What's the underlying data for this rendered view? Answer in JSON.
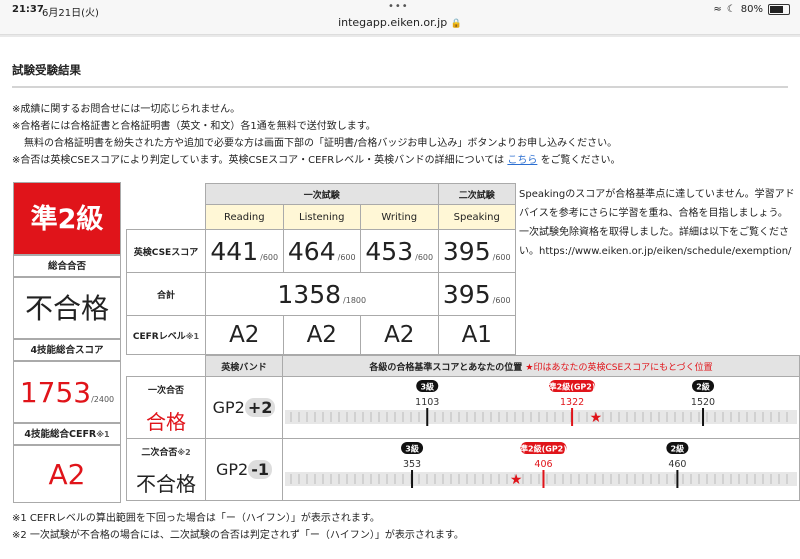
{
  "status_bar": {
    "time": "21:37",
    "date": "6月21日(火)",
    "url": "integapp.eiken.or.jp",
    "battery": "80%",
    "battery_level": 0.8
  },
  "page_title": "試験受験結果",
  "notes": {
    "n1": "※成績に関するお問合せには一切応じられません。",
    "n2": "※合格者には合格証書と合格証明書（英文・和文）各1通を無料で送付致します。",
    "n2b": "無料の合格証明書を紛失された方や追加で必要な方は画面下部の「証明書/合格バッジお申し込み」ボタンよりお申し込みください。",
    "n3_pre": "※合否は英検CSEスコアにより判定しています。英検CSEスコア・CEFRレベル・英検バンドの詳細については",
    "n3_link": "こちら",
    "n3_post": "をご覧ください。"
  },
  "summary": {
    "grade": "準2級",
    "overall_label": "総合合否",
    "overall_value": "不合格",
    "total4_label": "4技能総合スコア",
    "total4_value": "1753",
    "total4_max": "/2400",
    "cefr4_label": "4技能総合CEFR",
    "cefr4_note": "※1",
    "cefr4_value": "A2"
  },
  "scores": {
    "first_header": "一次試験",
    "second_header": "二次試験",
    "cols": [
      "Reading",
      "Listening",
      "Writing",
      "Speaking"
    ],
    "cse_label": "英検CSEスコア",
    "cse": [
      {
        "v": "441",
        "max": "/600"
      },
      {
        "v": "464",
        "max": "/600"
      },
      {
        "v": "453",
        "max": "/600"
      },
      {
        "v": "395",
        "max": "/600"
      }
    ],
    "total_label": "合計",
    "total_first": "1358",
    "total_first_max": "/1800",
    "total_second": "395",
    "total_second_max": "/600",
    "cefr_label": "CEFRレベル",
    "cefr_note": "※1",
    "cefr": [
      "A2",
      "A2",
      "A2",
      "A1"
    ]
  },
  "advice": "Speakingのスコアが合格基準点に達していません。学習アドバイスを参考にさらに学習を重ね、合格を目指しましょう。一次試験免除資格を取得しました。詳細は以下をご覧ください。https://www.eiken.or.jp/eiken/schedule/exemption/",
  "bands": {
    "band_header": "英検バンド",
    "scale_header": "各級の合格基準スコアとあなたの位置",
    "scale_header_star": "★印はあなたの英検CSEスコアにもとづく位置",
    "first": {
      "label": "一次合否",
      "result": "合格",
      "band_main": "GP2",
      "band_delta": "+2",
      "markers": [
        {
          "grade": "3級",
          "score": 1103,
          "label": "1103",
          "highlight": false
        },
        {
          "grade": "準2級(GP2)",
          "score": 1322,
          "label": "1322",
          "highlight": true
        },
        {
          "grade": "2級",
          "score": 1520,
          "label": "1520",
          "highlight": false
        }
      ],
      "my_score": 1358,
      "range": [
        900,
        1650
      ]
    },
    "second": {
      "label": "二次合否",
      "note": "※2",
      "result": "不合格",
      "band_main": "GP2",
      "band_delta": "-1",
      "markers": [
        {
          "grade": "3級",
          "score": 353,
          "label": "353",
          "highlight": false
        },
        {
          "grade": "準2級(GP2)",
          "score": 406,
          "label": "406",
          "highlight": true
        },
        {
          "grade": "2級",
          "score": 460,
          "label": "460",
          "highlight": false
        }
      ],
      "my_score": 395,
      "range": [
        305,
        505
      ]
    }
  },
  "footnotes": {
    "f1": "※1 CEFRレベルの算出範囲を下回った場合は「ー（ハイフン）」が表示されます。",
    "f2": "※2 一次試験が不合格の場合には、二次試験の合否は判定されず「ー（ハイフン）」が表示されます。"
  },
  "colors": {
    "accent_red": "#e0141a",
    "link_blue": "#2c6fd1",
    "header_gray": "#e3e3e3",
    "header_yellow": "#fff7d6"
  }
}
